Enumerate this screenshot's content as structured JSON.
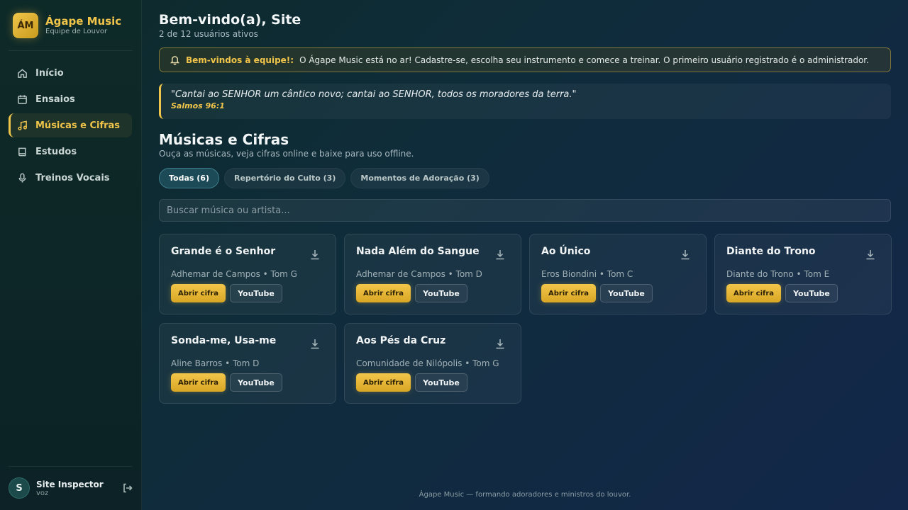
{
  "brand": {
    "logo": "ÁM",
    "name": "Ágape Music",
    "subtitle": "Equipe de Louvor"
  },
  "sidebar": {
    "items": [
      {
        "label": "Início",
        "icon": "home-icon"
      },
      {
        "label": "Ensaios",
        "icon": "calendar-icon"
      },
      {
        "label": "Músicas e Cifras",
        "icon": "music-note-icon",
        "active": true
      },
      {
        "label": "Estudos",
        "icon": "book-icon"
      },
      {
        "label": "Treinos Vocais",
        "icon": "microphone-icon"
      }
    ]
  },
  "user": {
    "initial": "S",
    "name": "Site Inspector",
    "role": "voz"
  },
  "header": {
    "welcome": "Bem-vindo(a), Site",
    "active_users": "2 de 12 usuários ativos"
  },
  "notice": {
    "title": "Bem-vindos à equipe!:",
    "text": "O Ágape Music está no ar! Cadastre-se, escolha seu instrumento e comece a treinar. O primeiro usuário registrado é o administrador."
  },
  "verse": {
    "text": "\"Cantai ao SENHOR um cântico novo; cantai ao SENHOR, todos os moradores da terra.\"",
    "reference": "Salmos 96:1"
  },
  "section": {
    "title": "Músicas e Cifras",
    "subtitle": "Ouça as músicas, veja cifras online e baixe para uso offline."
  },
  "tabs": [
    {
      "label": "Todas (6)",
      "active": true
    },
    {
      "label": "Repertório do Culto (3)"
    },
    {
      "label": "Momentos de Adoração (3)"
    }
  ],
  "search": {
    "placeholder": "Buscar música ou artista..."
  },
  "buttons": {
    "open_chord": "Abrir cifra",
    "youtube": "YouTube"
  },
  "songs": [
    {
      "title": "Grande é o Senhor",
      "meta": "Adhemar de Campos • Tom G"
    },
    {
      "title": "Nada Além do Sangue",
      "meta": "Adhemar de Campos • Tom D"
    },
    {
      "title": "Ao Único",
      "meta": "Eros Biondini • Tom C"
    },
    {
      "title": "Diante do Trono",
      "meta": "Diante do Trono • Tom E"
    },
    {
      "title": "Sonda-me, Usa-me",
      "meta": "Aline Barros • Tom D"
    },
    {
      "title": "Aos Pés da Cruz",
      "meta": "Comunidade de Nilópolis • Tom G"
    }
  ],
  "footer": "Ágape Music — formando adoradores e ministros do louvor.",
  "colors": {
    "accent": "#f0c64a",
    "active_tab": "#1d4a57"
  }
}
